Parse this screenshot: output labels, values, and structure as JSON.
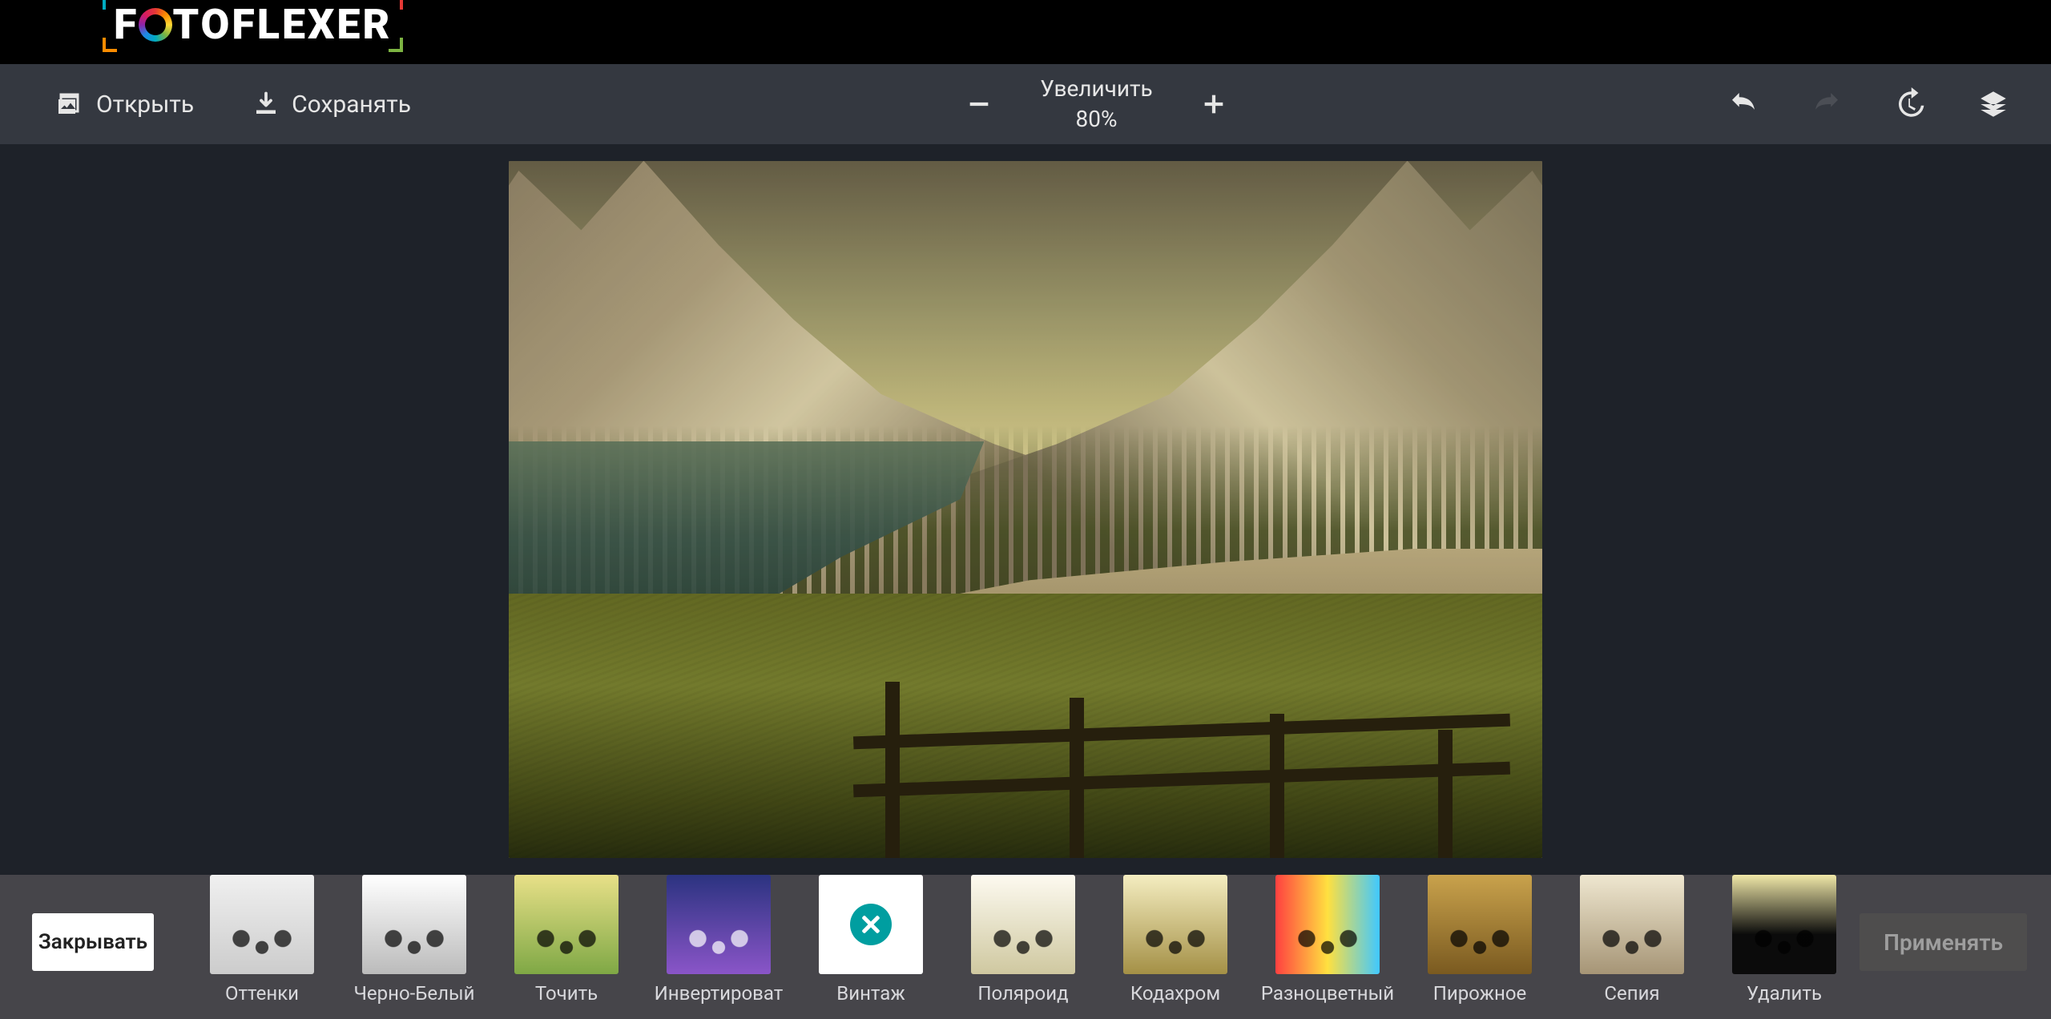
{
  "app": {
    "name": "FOTOFLEXER",
    "logo_rest": "TOFLEXER"
  },
  "toolbar": {
    "open_label": "Открыть",
    "save_label": "Сохранять",
    "zoom": {
      "title": "Увеличить",
      "percent": "80%"
    }
  },
  "filters": {
    "close_label": "Закрывать",
    "apply_label": "Применять",
    "selected_index": 4,
    "items": [
      {
        "label": "Оттенки",
        "style": "f-gray"
      },
      {
        "label": "Черно-Белый",
        "style": "f-bw"
      },
      {
        "label": "Точить",
        "style": "f-sharp"
      },
      {
        "label": "Инвертироват",
        "style": "f-invert"
      },
      {
        "label": "Винтаж",
        "style": "f-vintage"
      },
      {
        "label": "Поляроид",
        "style": "f-polar"
      },
      {
        "label": "Кодахром",
        "style": "f-koda"
      },
      {
        "label": "Разноцветный",
        "style": "f-techni"
      },
      {
        "label": "Пирожное",
        "style": "f-brown"
      },
      {
        "label": "Сепия",
        "style": "f-sepia"
      },
      {
        "label": "Удалить",
        "style": "f-remove"
      }
    ]
  }
}
